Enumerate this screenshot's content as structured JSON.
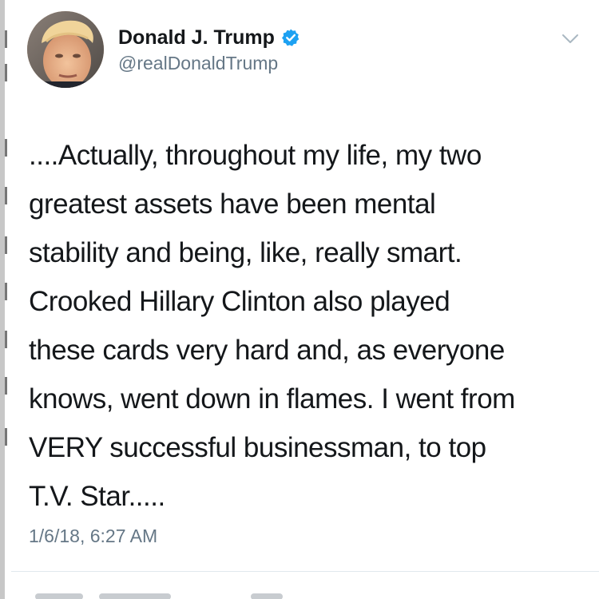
{
  "tweet": {
    "author": {
      "display_name": "Donald J. Trump",
      "handle": "@realDonaldTrump",
      "verified": true,
      "avatar_icon": "profile-photo"
    },
    "text": "....Actually, throughout my life, my two\ngreatest assets have been mental\nstability and being, like, really smart.\nCrooked Hillary Clinton also played\nthese cards very hard and, as everyone\nknows, went down in flames. I went from\nVERY successful businessman, to top\nT.V. Star.....",
    "timestamp": "1/6/18, 6:27 AM",
    "menu_icon": "chevron-down-icon"
  },
  "colors": {
    "text_primary": "#14171a",
    "text_secondary": "#657786",
    "verified_blue": "#1da1f2",
    "divider": "#e1e8ed"
  }
}
